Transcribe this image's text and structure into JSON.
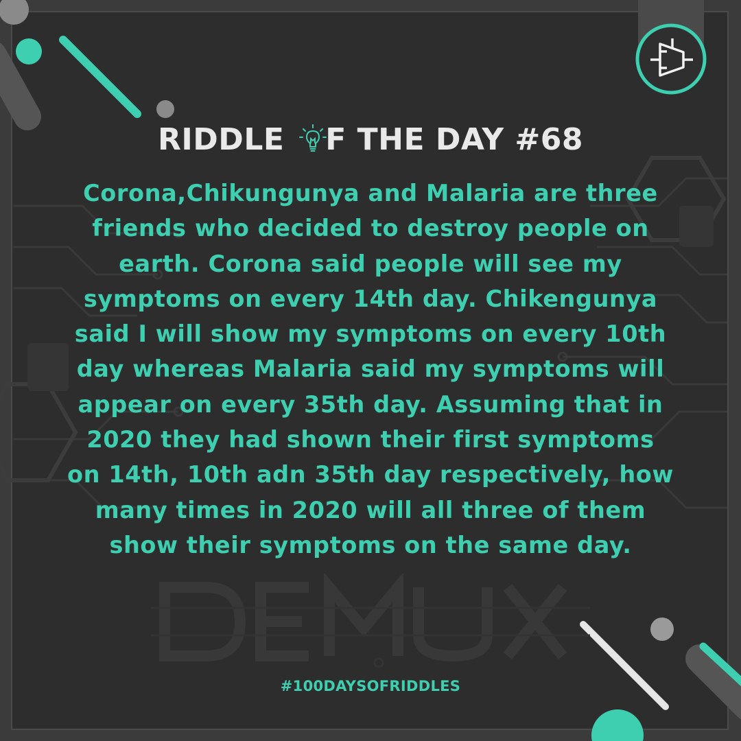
{
  "post": {
    "title_before": "RIDDLE ",
    "title_after": "F THE DAY #68",
    "riddle_lines": [
      "Corona,Chikungunya and Malaria are three",
      "friends who decided to destroy people on",
      "earth. Corona said people will see my",
      "symptoms on every 14th day. Chikengunya",
      "said I will show my symptoms on every 10th",
      "day whereas Malaria said my symptoms will",
      "appear on every 35th day. Assuming that in",
      "2020 they had shown their first symptoms",
      "on 14th, 10th adn 35th day respectively, how",
      "many times in 2020 will all three of them",
      "show their symptoms on the same day."
    ],
    "hashtag": "#100DAYSOFRIDDLES"
  },
  "icons": {
    "title_o": "lightbulb-icon",
    "logo": "demux-gate-icon"
  },
  "colors": {
    "accent": "#3ecfb0",
    "title": "#e9e9e9",
    "background": "#2d2d2d",
    "frame": "#3b3b3b"
  }
}
